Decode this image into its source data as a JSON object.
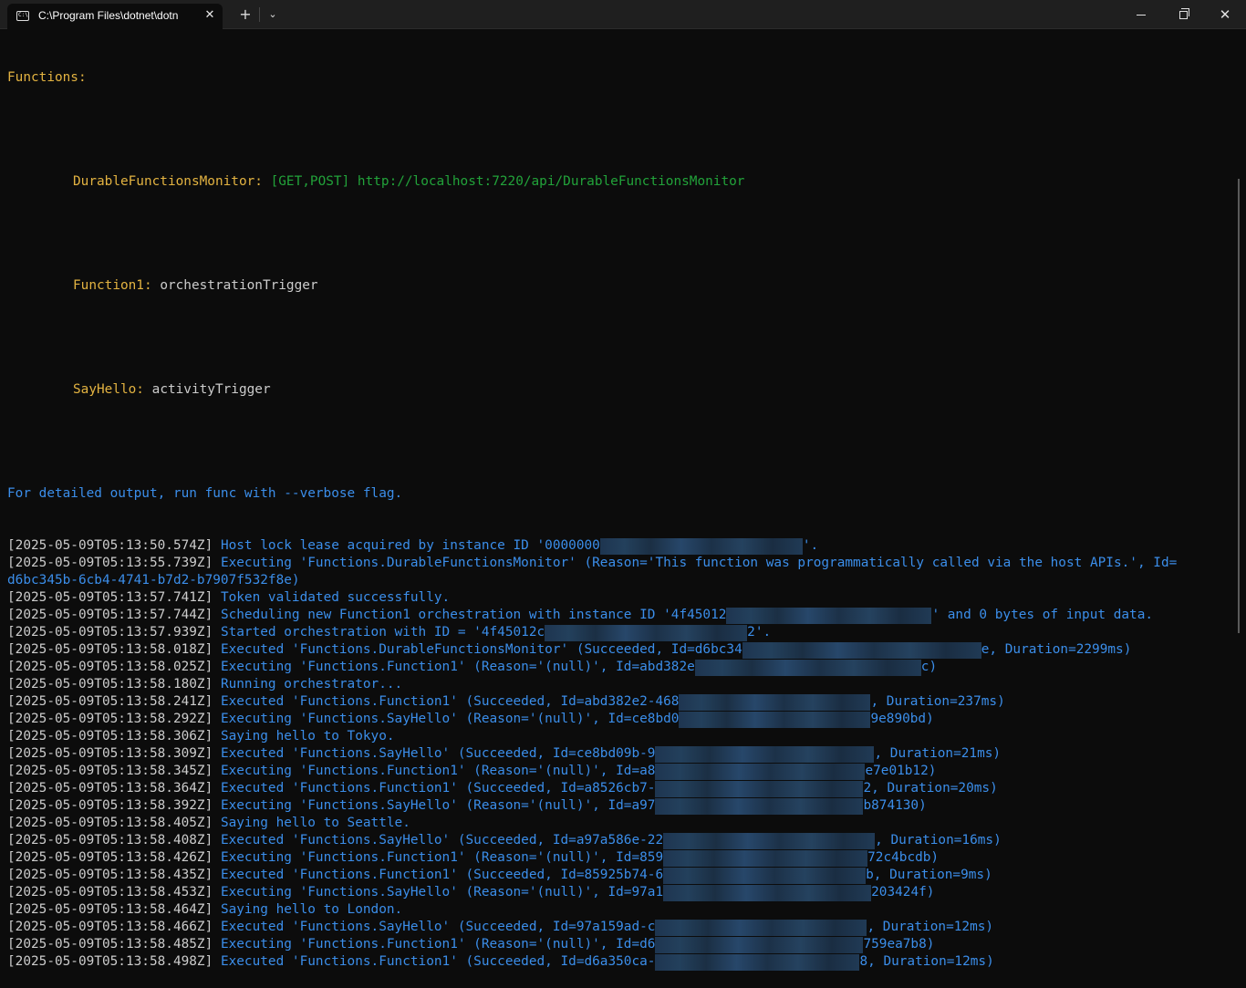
{
  "window": {
    "tab_title": "C:\\Program Files\\dotnet\\dotn",
    "icons": [
      "terminal-icon",
      "close-icon",
      "plus-icon",
      "chevron-down-icon",
      "minimize-icon",
      "maximize-icon",
      "close-icon"
    ]
  },
  "colors": {
    "background": "#0c0c0c",
    "yellow": "#e3b341",
    "green": "#22a33a",
    "blue": "#3b8eea",
    "white": "#cccccc"
  },
  "console": {
    "header": "Functions:",
    "functions": [
      {
        "name": "DurableFunctionsMonitor:",
        "detail": "[GET,POST] http://localhost:7220/api/DurableFunctionsMonitor"
      },
      {
        "name": "Function1:",
        "detail": "orchestrationTrigger"
      },
      {
        "name": "SayHello:",
        "detail": "activityTrigger"
      }
    ],
    "verbose_hint": "For detailed output, run func with --verbose flag.",
    "logs": [
      {
        "ts": "[2025-05-09T05:13:50.574Z]",
        "msg": "Host lock lease acquired by instance ID '0000000",
        "tail": "'."
      },
      {
        "ts": "[2025-05-09T05:13:55.739Z]",
        "msg": "Executing 'Functions.DurableFunctionsMonitor' (Reason='This function was programmatically called via the host APIs.', Id=",
        "tail": ""
      },
      {
        "ts": "",
        "msg": "d6bc345b-6cb4-4741-b7d2-b7907f532f8e)",
        "tail": ""
      },
      {
        "ts": "[2025-05-09T05:13:57.741Z]",
        "msg": "Token validated successfully.",
        "tail": ""
      },
      {
        "ts": "[2025-05-09T05:13:57.744Z]",
        "msg": "Scheduling new Function1 orchestration with instance ID '4f45012",
        "tail": "' and 0 bytes of input data."
      },
      {
        "ts": "[2025-05-09T05:13:57.939Z]",
        "msg": "Started orchestration with ID = '4f45012c",
        "tail": "2'."
      },
      {
        "ts": "[2025-05-09T05:13:58.018Z]",
        "msg": "Executed 'Functions.DurableFunctionsMonitor' (Succeeded, Id=d6bc34",
        "tail": "e, Duration=2299ms)"
      },
      {
        "ts": "[2025-05-09T05:13:58.025Z]",
        "msg": "Executing 'Functions.Function1' (Reason='(null)', Id=abd382e",
        "tail": "c)"
      },
      {
        "ts": "[2025-05-09T05:13:58.180Z]",
        "msg": "Running orchestrator...",
        "tail": ""
      },
      {
        "ts": "[2025-05-09T05:13:58.241Z]",
        "msg": "Executed 'Functions.Function1' (Succeeded, Id=abd382e2-468",
        "tail": ", Duration=237ms)"
      },
      {
        "ts": "[2025-05-09T05:13:58.292Z]",
        "msg": "Executing 'Functions.SayHello' (Reason='(null)', Id=ce8bd0",
        "tail": "9e890bd)"
      },
      {
        "ts": "[2025-05-09T05:13:58.306Z]",
        "msg": "Saying hello to Tokyo.",
        "tail": ""
      },
      {
        "ts": "[2025-05-09T05:13:58.309Z]",
        "msg": "Executed 'Functions.SayHello' (Succeeded, Id=ce8bd09b-9",
        "tail": ", Duration=21ms)"
      },
      {
        "ts": "[2025-05-09T05:13:58.345Z]",
        "msg": "Executing 'Functions.Function1' (Reason='(null)', Id=a8",
        "tail": "e7e01b12)"
      },
      {
        "ts": "[2025-05-09T05:13:58.364Z]",
        "msg": "Executed 'Functions.Function1' (Succeeded, Id=a8526cb7-",
        "tail": "2, Duration=20ms)"
      },
      {
        "ts": "[2025-05-09T05:13:58.392Z]",
        "msg": "Executing 'Functions.SayHello' (Reason='(null)', Id=a97",
        "tail": "b874130)"
      },
      {
        "ts": "[2025-05-09T05:13:58.405Z]",
        "msg": "Saying hello to Seattle.",
        "tail": ""
      },
      {
        "ts": "[2025-05-09T05:13:58.408Z]",
        "msg": "Executed 'Functions.SayHello' (Succeeded, Id=a97a586e-22",
        "tail": ", Duration=16ms)"
      },
      {
        "ts": "[2025-05-09T05:13:58.426Z]",
        "msg": "Executing 'Functions.Function1' (Reason='(null)', Id=859",
        "tail": "72c4bcdb)"
      },
      {
        "ts": "[2025-05-09T05:13:58.435Z]",
        "msg": "Executed 'Functions.Function1' (Succeeded, Id=85925b74-6",
        "tail": "b, Duration=9ms)"
      },
      {
        "ts": "[2025-05-09T05:13:58.453Z]",
        "msg": "Executing 'Functions.SayHello' (Reason='(null)', Id=97a1",
        "tail": "203424f)"
      },
      {
        "ts": "[2025-05-09T05:13:58.464Z]",
        "msg": "Saying hello to London.",
        "tail": ""
      },
      {
        "ts": "[2025-05-09T05:13:58.466Z]",
        "msg": "Executed 'Functions.SayHello' (Succeeded, Id=97a159ad-c",
        "tail": ", Duration=12ms)"
      },
      {
        "ts": "[2025-05-09T05:13:58.485Z]",
        "msg": "Executing 'Functions.Function1' (Reason='(null)', Id=d6",
        "tail": "759ea7b8)"
      },
      {
        "ts": "[2025-05-09T05:13:58.498Z]",
        "msg": "Executed 'Functions.Function1' (Succeeded, Id=d6a350ca-",
        "tail": "8, Duration=12ms)"
      }
    ]
  }
}
